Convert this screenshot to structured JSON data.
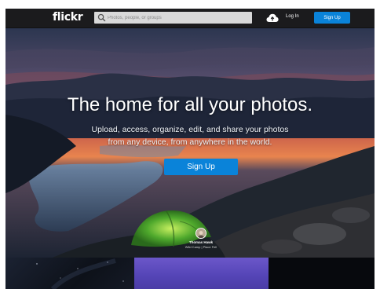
{
  "header": {
    "logo": "flickr",
    "search_placeholder": "Photos, people, or groups",
    "login_label": "Log In",
    "signup_label": "Sign Up"
  },
  "hero": {
    "headline": "The home for all your photos.",
    "subline_1": "Upload, access, organize, edit, and share your photos",
    "subline_2": "from any device, from anywhere in the world.",
    "signup_label": "Sign Up",
    "credit_name": "Thomas Hawk",
    "credit_sub": "Wild Camp | Place Fell"
  },
  "colors": {
    "accent": "#0a83d9",
    "topbar": "#1b1b1d"
  },
  "icons": {
    "search": "search-icon",
    "upload": "cloud-upload-icon"
  }
}
